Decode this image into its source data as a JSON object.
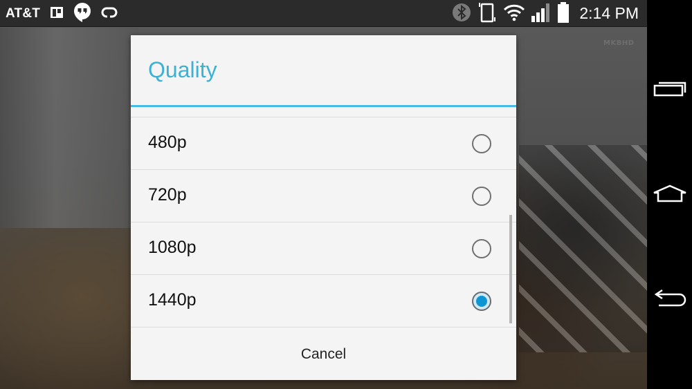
{
  "status_bar": {
    "carrier": "AT&T",
    "notification_icons": [
      "trello-icon",
      "hangouts-icon",
      "lg-quick-icon"
    ],
    "system_icons": [
      "bluetooth-icon",
      "vibrate-icon",
      "wifi-icon",
      "signal-icon",
      "battery-icon"
    ],
    "time": "2:14 PM"
  },
  "watermark": "MKBHD",
  "dialog": {
    "title": "Quality",
    "accent_color": "#33b5e5",
    "options": [
      {
        "label": "480p",
        "selected": false
      },
      {
        "label": "720p",
        "selected": false
      },
      {
        "label": "1080p",
        "selected": false
      },
      {
        "label": "1440p",
        "selected": true
      }
    ],
    "cancel_label": "Cancel"
  },
  "nav_bar": {
    "buttons": [
      "recent-apps",
      "home",
      "back"
    ]
  }
}
